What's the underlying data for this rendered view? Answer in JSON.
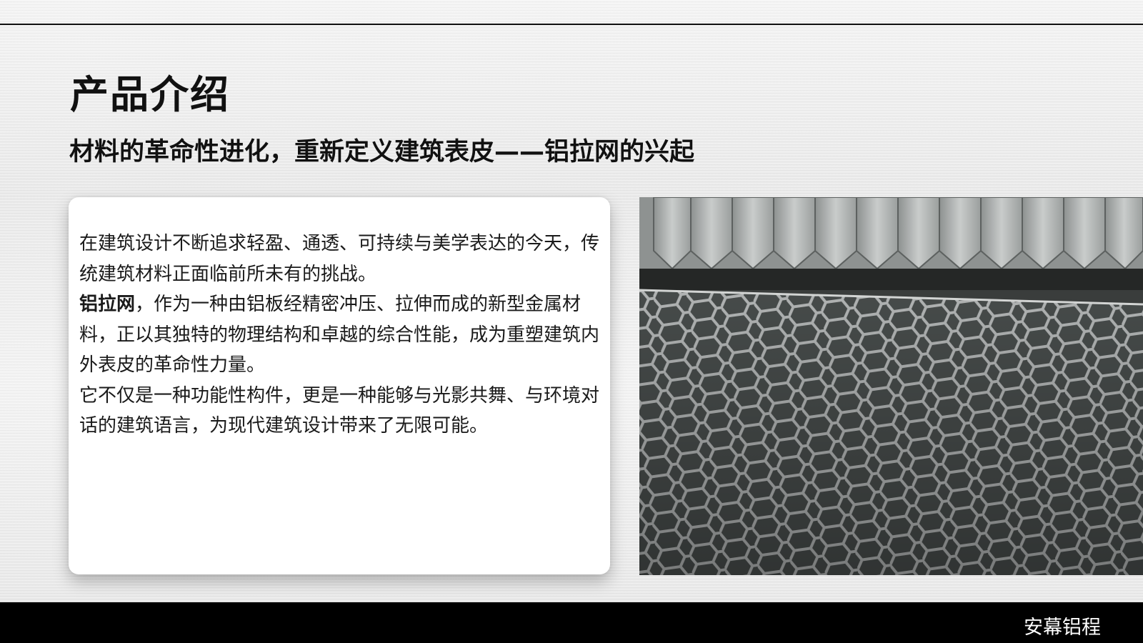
{
  "slide": {
    "title": "产品介绍",
    "subtitle": "材料的革命性进化，重新定义建筑表皮——铝拉网的兴起",
    "card": {
      "intro": "在建筑设计不断追求轻盈、通透、可持续与美学表达的今天，传统建筑材料正面临前所未有的挑战。",
      "highlight_term": "铝拉网",
      "paragraph_2": "，作为一种由铝板经精密冲压、拉伸而成的新型金属材料，正以其独特的物理结构和卓越的综合性能，成为重塑建筑内外表皮的革命性力量。",
      "paragraph_3": "它不仅是一种功能性构件，更是一种能够与光影共舞、与环境对话的建筑语言，为现代建筑设计带来了无限可能。"
    },
    "photo": {
      "subject": "expanded aluminum mesh under stamping machine"
    },
    "footer": {
      "brand": "安幕铝程"
    }
  },
  "colors": {
    "title": "#111111",
    "footer_bg": "#000000",
    "footer_text": "#ffffff",
    "card_bg": "#ffffff"
  }
}
